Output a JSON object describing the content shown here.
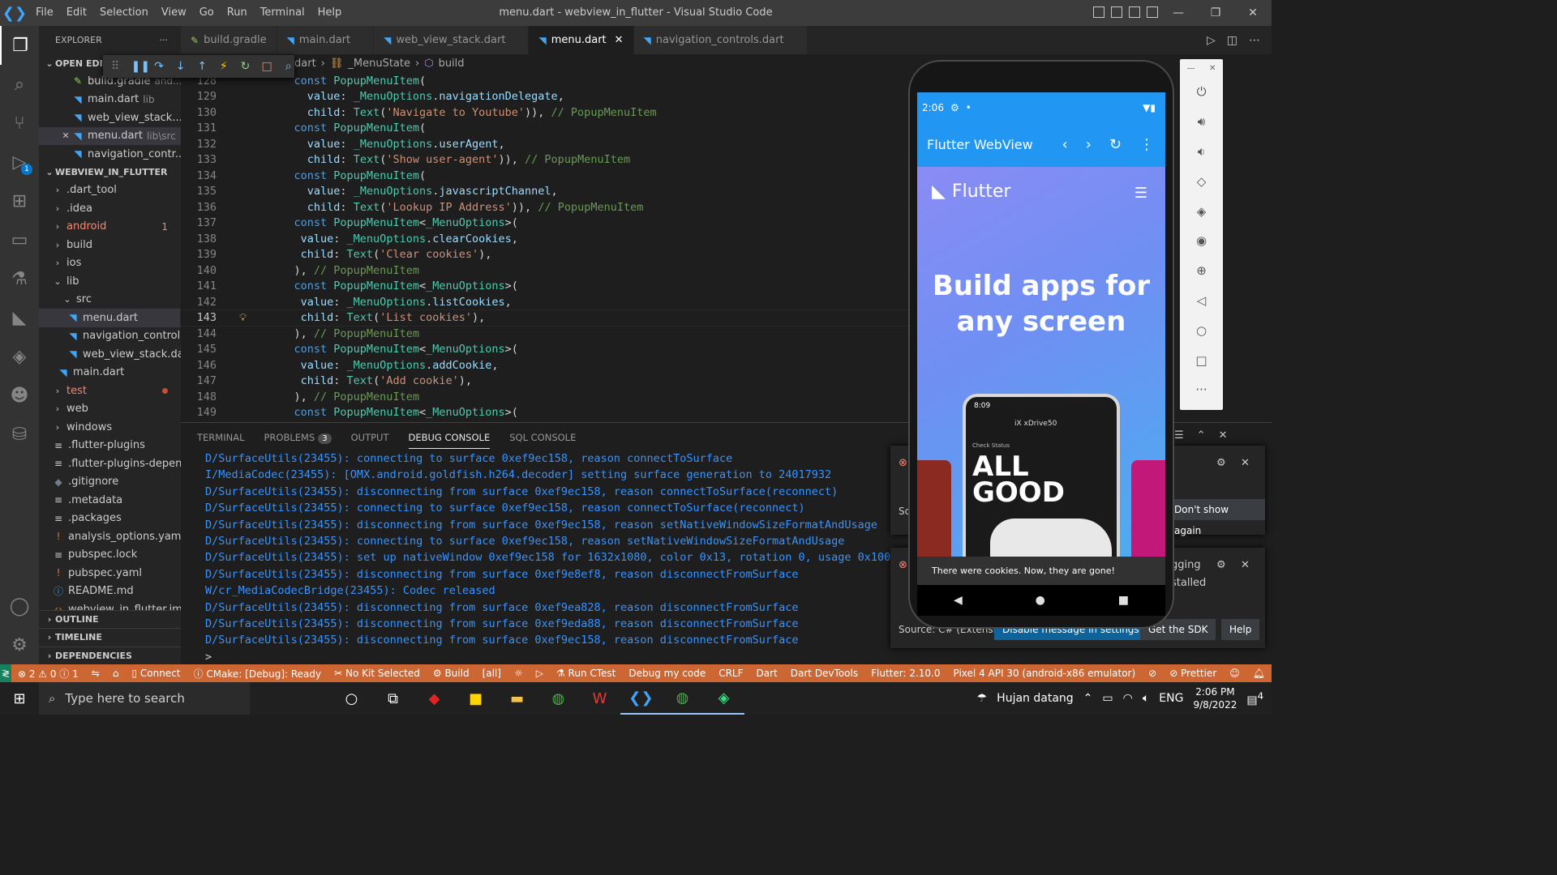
{
  "window": {
    "title": "menu.dart - webview_in_flutter - Visual Studio Code",
    "menus": [
      "File",
      "Edit",
      "Selection",
      "View",
      "Go",
      "Run",
      "Terminal",
      "Help"
    ]
  },
  "activity_badges": {
    "debug": "1"
  },
  "explorer": {
    "title": "EXPLORER",
    "more": "···",
    "open_editors_label": "OPEN EDITORS",
    "open_editors": [
      {
        "name": "build.gradle",
        "desc": "and..."
      },
      {
        "name": "main.dart",
        "desc": "lib"
      },
      {
        "name": "web_view_stack...",
        "desc": ""
      },
      {
        "name": "menu.dart",
        "desc": "lib\\src"
      },
      {
        "name": "navigation_contr...",
        "desc": ""
      }
    ],
    "project_label": "WEBVIEW_IN_FLUTTER",
    "tree": [
      {
        "name": ".dart_tool",
        "count": ""
      },
      {
        "name": ".idea",
        "count": ""
      },
      {
        "name": "android",
        "count": "1"
      },
      {
        "name": "build",
        "count": ""
      },
      {
        "name": "ios",
        "count": ""
      },
      {
        "name": "lib",
        "count": ""
      },
      {
        "name": "src",
        "count": ""
      },
      {
        "name": "menu.dart",
        "count": ""
      },
      {
        "name": "navigation_control...",
        "count": ""
      },
      {
        "name": "web_view_stack.dart",
        "count": ""
      },
      {
        "name": "main.dart",
        "count": ""
      },
      {
        "name": "test",
        "count": ""
      },
      {
        "name": "web",
        "count": ""
      },
      {
        "name": "windows",
        "count": ""
      },
      {
        "name": ".flutter-plugins",
        "count": ""
      },
      {
        "name": ".flutter-plugins-depen...",
        "count": ""
      },
      {
        "name": ".gitignore",
        "count": ""
      },
      {
        "name": ".metadata",
        "count": ""
      },
      {
        "name": ".packages",
        "count": ""
      },
      {
        "name": "analysis_options.yaml",
        "count": ""
      },
      {
        "name": "pubspec.lock",
        "count": ""
      },
      {
        "name": "pubspec.yaml",
        "count": ""
      },
      {
        "name": "README.md",
        "count": ""
      },
      {
        "name": "webview_in_flutter.iml",
        "count": ""
      }
    ],
    "outline_label": "OUTLINE",
    "timeline_label": "TIMELINE",
    "dependencies_label": "DEPENDENCIES"
  },
  "tabs": [
    {
      "name": "build.gradle"
    },
    {
      "name": "main.dart"
    },
    {
      "name": "web_view_stack.dart"
    },
    {
      "name": "menu.dart"
    },
    {
      "name": "navigation_controls.dart"
    }
  ],
  "tab_close": "✕",
  "breadcrumb": {
    "file": "dart",
    "class": "_MenuState",
    "method": "build"
  },
  "code": {
    "lines": [
      {
        "n": "128",
        "indent": "    ",
        "parts": [
          [
            "kw",
            "const "
          ],
          [
            "cls",
            "PopupMenuItem"
          ],
          [
            "",
            "("
          ]
        ]
      },
      {
        "n": "129",
        "indent": "      ",
        "parts": [
          [
            "prop",
            "value"
          ],
          [
            "",
            ": "
          ],
          [
            "cls",
            "_MenuOptions"
          ],
          [
            "",
            "."
          ],
          [
            "prop",
            "navigationDelegate"
          ],
          [
            "",
            ","
          ]
        ]
      },
      {
        "n": "130",
        "indent": "      ",
        "parts": [
          [
            "prop",
            "child"
          ],
          [
            "",
            ": "
          ],
          [
            "cls",
            "Text"
          ],
          [
            "",
            "("
          ],
          [
            "str",
            "'Navigate to Youtube'"
          ],
          [
            "",
            ")), "
          ],
          [
            "cmt",
            "// PopupMenuItem"
          ]
        ]
      },
      {
        "n": "131",
        "indent": "    ",
        "parts": [
          [
            "kw",
            "const "
          ],
          [
            "cls",
            "PopupMenuItem"
          ],
          [
            "",
            "("
          ]
        ]
      },
      {
        "n": "132",
        "indent": "      ",
        "parts": [
          [
            "prop",
            "value"
          ],
          [
            "",
            ": "
          ],
          [
            "cls",
            "_MenuOptions"
          ],
          [
            "",
            "."
          ],
          [
            "prop",
            "userAgent"
          ],
          [
            "",
            ","
          ]
        ]
      },
      {
        "n": "133",
        "indent": "      ",
        "parts": [
          [
            "prop",
            "child"
          ],
          [
            "",
            ": "
          ],
          [
            "cls",
            "Text"
          ],
          [
            "",
            "("
          ],
          [
            "str",
            "'Show user-agent'"
          ],
          [
            "",
            "))"
          ],
          [
            "",
            ", "
          ],
          [
            "cmt",
            "// PopupMenuItem"
          ]
        ]
      },
      {
        "n": "134",
        "indent": "    ",
        "parts": [
          [
            "kw",
            "const "
          ],
          [
            "cls",
            "PopupMenuItem"
          ],
          [
            "",
            "("
          ]
        ]
      },
      {
        "n": "135",
        "indent": "      ",
        "parts": [
          [
            "prop",
            "value"
          ],
          [
            "",
            ": "
          ],
          [
            "cls",
            "_MenuOptions"
          ],
          [
            "",
            "."
          ],
          [
            "prop",
            "javascriptChannel"
          ],
          [
            "",
            ","
          ]
        ]
      },
      {
        "n": "136",
        "indent": "      ",
        "parts": [
          [
            "prop",
            "child"
          ],
          [
            "",
            ": "
          ],
          [
            "cls",
            "Text"
          ],
          [
            "",
            "("
          ],
          [
            "str",
            "'Lookup IP Address'"
          ],
          [
            "",
            "))"
          ],
          [
            "",
            ", "
          ],
          [
            "cmt",
            "// PopupMenuItem"
          ]
        ]
      },
      {
        "n": "137",
        "indent": "    ",
        "parts": [
          [
            "kw",
            "const "
          ],
          [
            "cls",
            "PopupMenuItem"
          ],
          [
            "",
            "<"
          ],
          [
            "cls",
            "_MenuOptions"
          ],
          [
            "",
            ">("
          ]
        ]
      },
      {
        "n": "138",
        "indent": "     ",
        "parts": [
          [
            "prop",
            "value"
          ],
          [
            "",
            ": "
          ],
          [
            "cls",
            "_MenuOptions"
          ],
          [
            "",
            "."
          ],
          [
            "prop",
            "clearCookies"
          ],
          [
            "",
            ","
          ]
        ]
      },
      {
        "n": "139",
        "indent": "     ",
        "parts": [
          [
            "prop",
            "child"
          ],
          [
            "",
            ": "
          ],
          [
            "cls",
            "Text"
          ],
          [
            "",
            "("
          ],
          [
            "str",
            "'Clear cookies'"
          ],
          [
            "",
            "),"
          ]
        ]
      },
      {
        "n": "140",
        "indent": "    ",
        "parts": [
          [
            "",
            "), "
          ],
          [
            "cmt",
            "// PopupMenuItem"
          ]
        ]
      },
      {
        "n": "141",
        "indent": "    ",
        "parts": [
          [
            "kw",
            "const "
          ],
          [
            "cls",
            "PopupMenuItem"
          ],
          [
            "",
            "<"
          ],
          [
            "cls",
            "_MenuOptions"
          ],
          [
            "",
            ">("
          ]
        ]
      },
      {
        "n": "142",
        "indent": "     ",
        "parts": [
          [
            "prop",
            "value"
          ],
          [
            "",
            ": "
          ],
          [
            "cls",
            "_MenuOptions"
          ],
          [
            "",
            "."
          ],
          [
            "prop",
            "listCookies"
          ],
          [
            "",
            ","
          ]
        ]
      },
      {
        "n": "143",
        "indent": "     ",
        "parts": [
          [
            "prop",
            "child"
          ],
          [
            "",
            ": "
          ],
          [
            "cls",
            "Text"
          ],
          [
            "",
            "("
          ],
          [
            "str",
            "'List cookies'"
          ],
          [
            "",
            "),"
          ]
        ]
      },
      {
        "n": "144",
        "indent": "    ",
        "parts": [
          [
            "",
            "), "
          ],
          [
            "cmt",
            "// PopupMenuItem"
          ]
        ]
      },
      {
        "n": "145",
        "indent": "    ",
        "parts": [
          [
            "kw",
            "const "
          ],
          [
            "cls",
            "PopupMenuItem"
          ],
          [
            "",
            "<"
          ],
          [
            "cls",
            "_MenuOptions"
          ],
          [
            "",
            ">("
          ]
        ]
      },
      {
        "n": "146",
        "indent": "     ",
        "parts": [
          [
            "prop",
            "value"
          ],
          [
            "",
            ": "
          ],
          [
            "cls",
            "_MenuOptions"
          ],
          [
            "",
            "."
          ],
          [
            "prop",
            "addCookie"
          ],
          [
            "",
            ","
          ]
        ]
      },
      {
        "n": "147",
        "indent": "     ",
        "parts": [
          [
            "prop",
            "child"
          ],
          [
            "",
            ": "
          ],
          [
            "cls",
            "Text"
          ],
          [
            "",
            "("
          ],
          [
            "str",
            "'Add cookie'"
          ],
          [
            "",
            "),"
          ]
        ]
      },
      {
        "n": "148",
        "indent": "    ",
        "parts": [
          [
            "",
            "), "
          ],
          [
            "cmt",
            "// PopupMenuItem"
          ]
        ]
      },
      {
        "n": "149",
        "indent": "    ",
        "parts": [
          [
            "kw",
            "const "
          ],
          [
            "cls",
            "PopupMenuItem"
          ],
          [
            "",
            "<"
          ],
          [
            "cls",
            "_MenuOptions"
          ],
          [
            "",
            ">("
          ]
        ]
      }
    ],
    "current_line": "143"
  },
  "panel": {
    "tabs": [
      "TERMINAL",
      "PROBLEMS",
      "OUTPUT",
      "DEBUG CONSOLE",
      "SQL CONSOLE"
    ],
    "problems_count": "3",
    "console": [
      "D/SurfaceUtils(23455): connecting to surface 0xef9ec158, reason connectToSurface",
      "I/MediaCodec(23455): [OMX.android.goldfish.h264.decoder] setting surface generation to 24017932",
      "D/SurfaceUtils(23455): disconnecting from surface 0xef9ec158, reason connectToSurface(reconnect)",
      "D/SurfaceUtils(23455): connecting to surface 0xef9ec158, reason connectToSurface(reconnect)",
      "D/SurfaceUtils(23455): disconnecting from surface 0xef9ec158, reason setNativeWindowSizeFormatAndUsage",
      "D/SurfaceUtils(23455): connecting to surface 0xef9ec158, reason setNativeWindowSizeFormatAndUsage",
      "D/SurfaceUtils(23455): set up nativeWindow 0xef9ec158 for 1632x1080, color 0x13, rotation 0, usage 0x100290",
      "D/SurfaceUtils(23455): disconnecting from surface 0xef9e8ef8, reason disconnectFromSurface",
      "W/cr_MediaCodecBridge(23455): Codec released",
      "D/SurfaceUtils(23455): disconnecting from surface 0xef9ea828, reason disconnectFromSurface",
      "D/SurfaceUtils(23455): disconnecting from surface 0xef9eda88, reason disconnectFromSurface",
      "D/SurfaceUtils(23455): disconnecting from surface 0xef9ec158, reason disconnectFromSurface"
    ],
    "prompt": ">"
  },
  "notifications": {
    "n1_left": "Sc",
    "n1_button": "Don't show again",
    "n2_text1": "gging",
    "n2_text2": "stalled",
    "n2_source": "Source: C# (Extensi...",
    "btn_disable": "Disable message in settings",
    "btn_sdk": "Get the SDK",
    "btn_help": "Help"
  },
  "phone": {
    "time": "2:06",
    "app_title": "Flutter WebView",
    "logo_text": "Flutter",
    "hero": "Build apps for any screen",
    "mock_time": "8:09",
    "mock_car": "iX xDrive50",
    "mock_status": "Check Status",
    "mock_headline": "ALL GOOD",
    "snackbar": "There were cookies. Now, they are gone!"
  },
  "status": {
    "errors": "2",
    "warnings": "0",
    "info": "1",
    "connect": "Connect",
    "cmake": "CMake: [Debug]: Ready",
    "kit": "No Kit Selected",
    "build": "Build",
    "all": "[all]",
    "ctest": "Run CTest",
    "debug": "Debug my code",
    "eol": "CRLF",
    "lang": "Dart",
    "devtools": "Dart DevTools",
    "flutter": "Flutter: 2.10.0",
    "device": "Pixel 4 API 30 (android-x86 emulator)",
    "prettier": "Prettier"
  },
  "taskbar": {
    "search_placeholder": "Type here to search",
    "weather": "Hujan datang",
    "lang": "ENG",
    "time": "2:06 PM",
    "date": "9/8/2022",
    "notif_count": "4"
  }
}
